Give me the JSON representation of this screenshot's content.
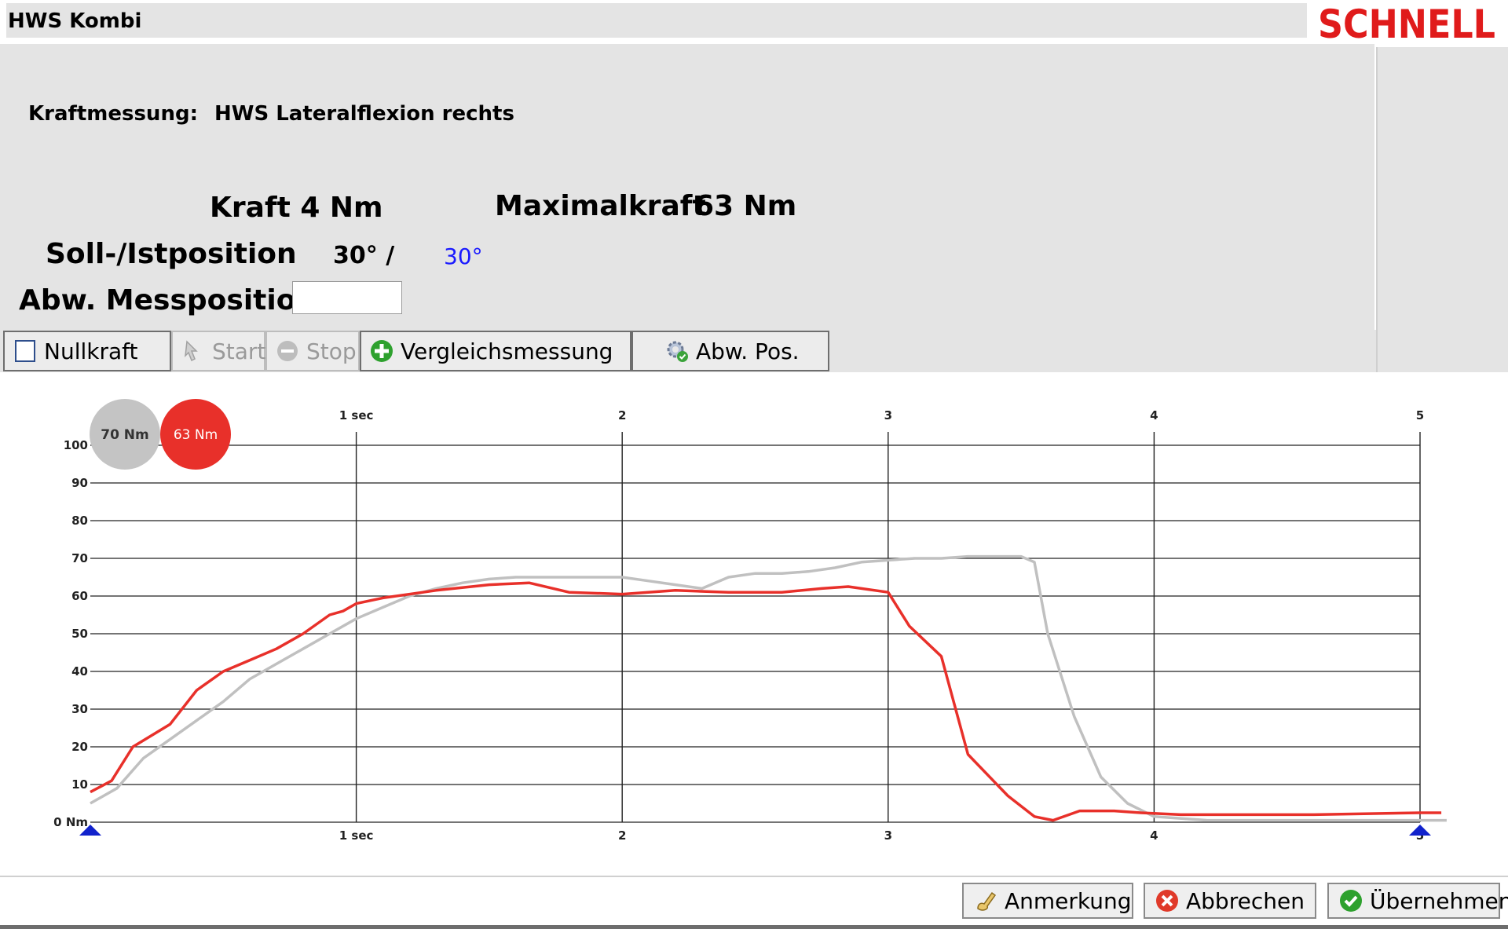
{
  "window": {
    "title": "HWS Kombi",
    "brand": "SCHNELL",
    "brand_color": "#e01b1b"
  },
  "header": {
    "measurement_label": "Kraftmessung:",
    "measurement_value": "HWS Lateralflexion rechts",
    "force_label": "Kraft 4 Nm",
    "maxforce_label": "Maximalkraft",
    "maxforce_value": "63 Nm",
    "position_label": "Soll-/Istposition",
    "position_target": "30° /",
    "position_actual": "30°",
    "deviation_label": "Abw. Messposition",
    "deviation_value": ""
  },
  "toolbar": {
    "nullkraft": "Nullkraft",
    "start": "Start",
    "stop": "Stop",
    "vergleich": "Vergleichsmessung",
    "abwpos": "Abw. Pos."
  },
  "chart_data": {
    "type": "line",
    "x_tick_labels": [
      "1 sec",
      "2",
      "3",
      "4",
      "5"
    ],
    "y_tick_labels": [
      "0 Nm",
      "10",
      "20",
      "30",
      "40",
      "50",
      "60",
      "70",
      "80",
      "90",
      "100"
    ],
    "xlim": [
      0,
      5
    ],
    "ylim": [
      0,
      100
    ],
    "grid": true,
    "badges": [
      {
        "label": "70 Nm",
        "color": "#c4c4c4"
      },
      {
        "label": "63 Nm",
        "color": "#e8302a"
      }
    ],
    "series": [
      {
        "color": "#e8302a",
        "x": [
          0,
          0.08,
          0.16,
          0.3,
          0.4,
          0.5,
          0.6,
          0.7,
          0.8,
          0.9,
          0.95,
          1.0,
          1.1,
          1.3,
          1.5,
          1.65,
          1.8,
          2.0,
          2.2,
          2.4,
          2.6,
          2.75,
          2.85,
          3.0,
          3.08,
          3.2,
          3.3,
          3.45,
          3.55,
          3.62,
          3.72,
          3.85,
          3.95,
          4.1,
          4.3,
          4.6,
          5.0,
          5.08
        ],
        "y": [
          8,
          11,
          20,
          26,
          35,
          40,
          43,
          46,
          50,
          55,
          56,
          58,
          59.5,
          61.5,
          63,
          63.5,
          61,
          60.5,
          61.5,
          61,
          61,
          62,
          62.5,
          61,
          52,
          44,
          18,
          7,
          1.5,
          0.5,
          3,
          3,
          2.5,
          2,
          2,
          2,
          2.5,
          2.5
        ]
      },
      {
        "color": "#c0c0c0",
        "x": [
          0,
          0.1,
          0.2,
          0.3,
          0.4,
          0.5,
          0.6,
          0.7,
          0.8,
          0.9,
          1.0,
          1.1,
          1.2,
          1.3,
          1.4,
          1.5,
          1.6,
          1.7,
          1.8,
          1.9,
          2.0,
          2.1,
          2.2,
          2.3,
          2.4,
          2.5,
          2.6,
          2.7,
          2.8,
          2.9,
          3.0,
          3.1,
          3.2,
          3.3,
          3.4,
          3.5,
          3.55,
          3.6,
          3.7,
          3.8,
          3.9,
          4.0,
          4.2,
          4.5,
          5.0,
          5.1
        ],
        "y": [
          5,
          9,
          17,
          22,
          27,
          32,
          38,
          42,
          46,
          50,
          54,
          57,
          60,
          62,
          63.5,
          64.5,
          65,
          65,
          65,
          65,
          65,
          64,
          63,
          62,
          65,
          66,
          66,
          66.5,
          67.5,
          69,
          69.5,
          70,
          70,
          70.5,
          70.5,
          70.5,
          69,
          50,
          28,
          12,
          5,
          1.5,
          0.5,
          0.5,
          0.5,
          0.5
        ]
      }
    ],
    "markers": [
      "start-marker",
      "end-marker"
    ],
    "marker_color": "#1122cc"
  },
  "footer": {
    "anmerkung": "Anmerkung",
    "abbrechen": "Abbrechen",
    "uebernehmen": "Übernehmen"
  }
}
